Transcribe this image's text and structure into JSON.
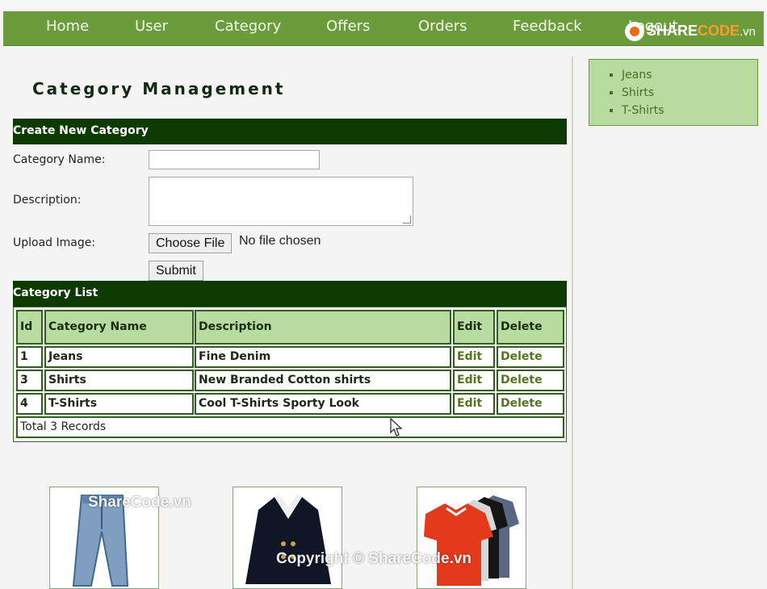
{
  "nav": {
    "items": [
      "Home",
      "User",
      "Category",
      "Offers",
      "Orders",
      "Feedback",
      "Logout"
    ]
  },
  "logo": {
    "brand_a": "SHARE",
    "brand_b": "CODE",
    "brand_c": ".vn",
    "icon": "sharecode-logo-icon"
  },
  "sidebar": {
    "items": [
      "Jeans",
      "Shirts",
      "T-Shirts"
    ]
  },
  "page": {
    "title": "Category Management"
  },
  "form": {
    "section_title": "Create New Category",
    "name_label": "Category Name:",
    "name_value": "",
    "description_label": "Description:",
    "description_value": "",
    "upload_label": "Upload Image:",
    "choose_file": "Choose File",
    "file_status": "No file chosen",
    "submit": "Submit"
  },
  "list": {
    "section_title": "Category List",
    "columns": [
      "Id",
      "Category Name",
      "Description",
      "Edit",
      "Delete"
    ],
    "rows": [
      {
        "id": "1",
        "name": "Jeans",
        "description": "Fine Denim",
        "edit": "Edit",
        "delete": "Delete"
      },
      {
        "id": "3",
        "name": "Shirts",
        "description": "New Branded Cotton shirts",
        "edit": "Edit",
        "delete": "Delete"
      },
      {
        "id": "4",
        "name": "T-Shirts",
        "description": "Cool T-Shirts Sporty Look",
        "edit": "Edit",
        "delete": "Delete"
      }
    ],
    "total": "Total 3 Records"
  },
  "watermarks": {
    "top": "ShareCode.vn",
    "bottom": "Copyright © ShareCode.vn"
  },
  "colors": {
    "nav": "#6b9c3c",
    "section_header": "#0d3a00",
    "table_header": "#b7dca0",
    "link": "#56741f"
  }
}
